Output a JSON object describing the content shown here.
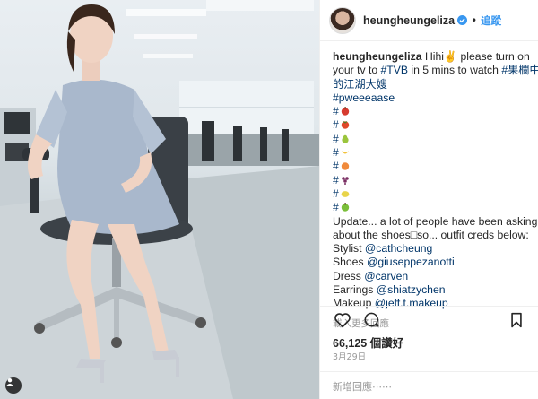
{
  "post": {
    "username": "heungheungeliza",
    "follow_label": "追蹤",
    "separator": "•"
  },
  "caption": {
    "username": "heungheungeliza",
    "intro": "Hihi✌️ please turn on",
    "line2_pre": "your tv to ",
    "tag_tvb": "#TVB",
    "line2_mid": " in 5 mins to watch ",
    "tag_show_a": "#果欄中",
    "tag_show_b": "的江湖大嫂",
    "tag_pweee": "#pweeeaase",
    "fruit_tags": [
      "#",
      "#",
      "#",
      "#",
      "#",
      "#",
      "#",
      "#"
    ],
    "update_1": "Update... a lot of people have been asking",
    "update_2": "about the shoes□so... outfit creds below:",
    "credits": [
      {
        "label": "Stylist ",
        "handle": "@cathcheung"
      },
      {
        "label": "Shoes ",
        "handle": "@giuseppezanotti"
      },
      {
        "label": "Dress ",
        "handle": "@carven"
      },
      {
        "label": "Earrings ",
        "handle": "@shiatzychen"
      },
      {
        "label": "Makeup ",
        "handle": "@jeff.t.makeup"
      }
    ],
    "load_more": "載入更多回應"
  },
  "stats": {
    "likes": "66,125 個讚好",
    "date": "3月29日"
  },
  "comment": {
    "placeholder": "新增回應⋯⋯"
  },
  "icons": {
    "verified": "verified-badge-icon",
    "like": "heart-outline-icon",
    "comment": "comment-bubble-icon",
    "bookmark": "bookmark-icon",
    "user_tag": "user-tag-icon"
  },
  "colors": {
    "link": "#003569",
    "follow": "#3897f0",
    "muted": "#999999",
    "fruits": [
      "#d63b2f",
      "#e0482a",
      "#9bc53d",
      "#f2c23a",
      "#f08a3c",
      "#7a2e63",
      "#e8d44a",
      "#7bbf3a"
    ]
  }
}
